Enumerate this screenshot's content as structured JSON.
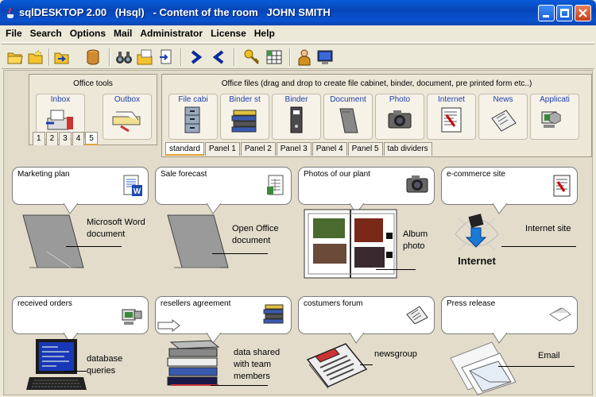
{
  "window": {
    "title": "sqlDESKTOP 2.00   (Hsql)   - Content of the room   JOHN SMITH"
  },
  "menu": [
    "File",
    "Search",
    "Options",
    "Mail",
    "Administrator",
    "License",
    "Help"
  ],
  "toolbar": [
    "open-folder-icon",
    "new-folder-icon",
    "back-folder-icon",
    "database-icon",
    "binoculars-icon",
    "folders-icon",
    "export-icon",
    "next-icon",
    "previous-icon",
    "key-icon",
    "grid-icon",
    "user-icon",
    "monitor-icon"
  ],
  "office_tools": {
    "title": "Office tools",
    "items": [
      {
        "label": "Inbox",
        "icon": "inbox-icon"
      },
      {
        "label": "Outbox",
        "icon": "outbox-icon"
      }
    ],
    "tabs": [
      "1",
      "2",
      "3",
      "4",
      "5"
    ],
    "active_tab": "5"
  },
  "office_files": {
    "title": "Office files (drag and drop to create file cabinet, binder, document, pre printed form etc..)",
    "items": [
      {
        "label": "File cabi",
        "icon": "file-cabinet-icon"
      },
      {
        "label": "Binder st",
        "icon": "binder-stack-icon"
      },
      {
        "label": "Binder",
        "icon": "binder-icon"
      },
      {
        "label": "Document",
        "icon": "document-icon"
      },
      {
        "label": "Photo",
        "icon": "camera-icon"
      },
      {
        "label": "Internet",
        "icon": "internet-icon"
      },
      {
        "label": "News",
        "icon": "news-icon"
      },
      {
        "label": "Applicati",
        "icon": "application-icon"
      }
    ],
    "tabs": [
      "standard",
      "Panel 1",
      "Panel 2",
      "Panel 3",
      "Panel 4",
      "Panel 5",
      "tab dividers"
    ],
    "active_tab": "standard"
  },
  "cards": [
    {
      "title": "Marketing plan",
      "caption": [
        "Microsoft Word",
        "document"
      ],
      "icon": "word-doc-icon",
      "picture": "folder-icon"
    },
    {
      "title": "Sale forecast",
      "caption": [
        "Open Office",
        "document"
      ],
      "icon": "spreadsheet-icon",
      "picture": "folder-icon"
    },
    {
      "title": "Photos of our plant",
      "caption": [
        "Album",
        "photo"
      ],
      "icon": "camera-icon",
      "picture": "photo-album-icon"
    },
    {
      "title": "e-commerce site",
      "caption": [
        "Internet site"
      ],
      "icon": "internet-doc-icon",
      "picture": "internet-logo-icon",
      "picture_text": "Internet"
    },
    {
      "title": "received orders",
      "caption": [
        "database",
        "queries"
      ],
      "icon": "app-icon",
      "picture": "laptop-icon"
    },
    {
      "title": "resellers agreement",
      "caption": [
        "data shared",
        "with team",
        "members"
      ],
      "icon": "binders-icon",
      "picture": "binder-stack-icon"
    },
    {
      "title": "costumers forum",
      "caption": [
        "newsgroup"
      ],
      "icon": "news-icon",
      "picture": "newspaper-icon"
    },
    {
      "title": "Press release",
      "caption": [
        "Email"
      ],
      "icon": "mail-icon",
      "picture": "envelope-icon"
    }
  ]
}
